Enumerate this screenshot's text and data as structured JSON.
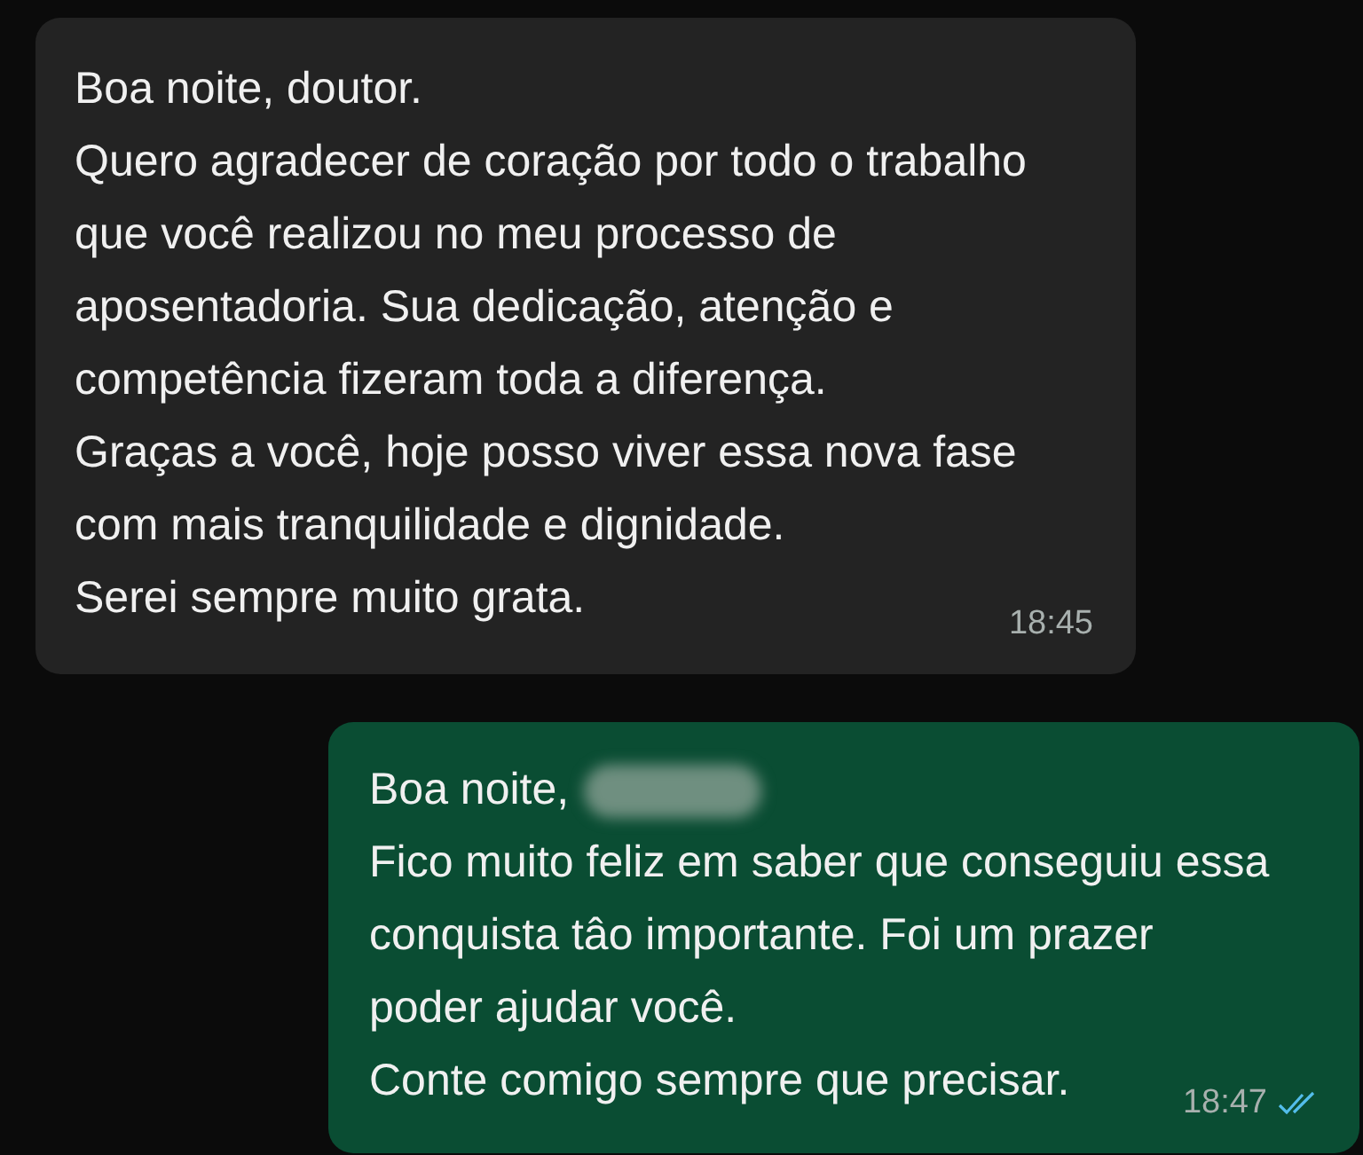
{
  "messages": [
    {
      "kind": "incoming",
      "lines": [
        "Boa noite, doutor.",
        "Quero agradecer de coração por todo o trabalho",
        "que você realizou no meu processo de",
        "aposentadoria. Sua dedicação, atenção e",
        "competência fizeram toda a diferença.",
        "Graças a você, hoje posso viver essa nova fase",
        "com mais tranquilidade e dignidade.",
        "Serei sempre muito grata."
      ],
      "time": "18:45"
    },
    {
      "kind": "outgoing",
      "lines": [
        "Boa noite,",
        "Fico muito feliz em saber que conseguiu essa",
        "conquista tâo importante. Foi um prazer",
        "poder ajudar você.",
        "Conte comigo sempre que precisar."
      ],
      "redacted_name": true,
      "time": "18:47",
      "read": true
    }
  ]
}
